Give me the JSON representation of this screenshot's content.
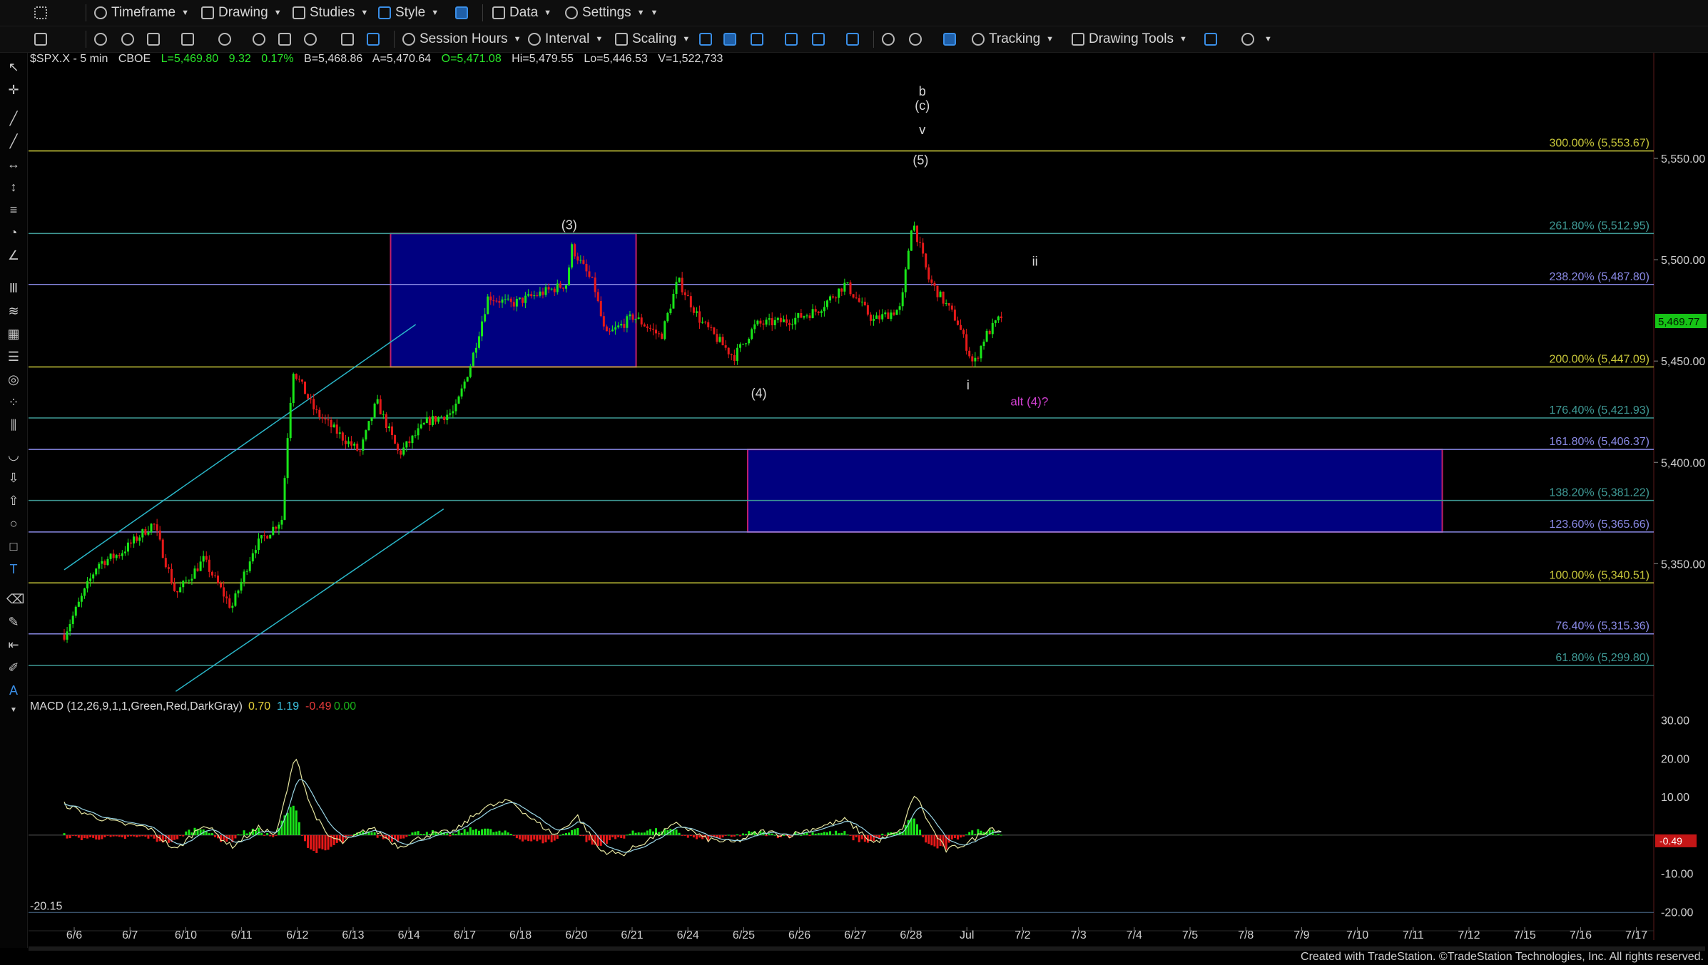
{
  "toolbar_top": {
    "timeframe": "Timeframe",
    "drawing": "Drawing",
    "studies": "Studies",
    "style": "Style",
    "data": "Data",
    "settings": "Settings"
  },
  "toolbar_second": {
    "session_hours": "Session Hours",
    "interval": "Interval",
    "scaling": "Scaling",
    "tracking": "Tracking",
    "drawing_tools": "Drawing Tools"
  },
  "symbol_bar": {
    "symbol": "$SPX.X - 5 min",
    "exchange": "CBOE",
    "last": "L=5,469.80",
    "change": "9.32",
    "change_pct": "0.17%",
    "bid": "B=5,468.86",
    "ask": "A=5,470.64",
    "open": "O=5,471.08",
    "high": "Hi=5,479.55",
    "low": "Lo=5,446.53",
    "volume": "V=1,522,733"
  },
  "footer": "Created with TradeStation. ©TradeStation Technologies, Inc. All rights reserved.",
  "colors": {
    "up": "#19e619",
    "down": "#e61919",
    "fib_yellow": "#c9c83a",
    "fib_blue": "#8a8ae6",
    "fib_teal": "#3f9a96",
    "box_fill": "#000080",
    "box_border": "#c0206a",
    "channel": "#2ab7c9"
  },
  "chart_data": [
    {
      "type": "candlestick",
      "title": "$SPX.X - 5 min",
      "x_labels": [
        "6/6",
        "6/7",
        "6/10",
        "6/11",
        "6/12",
        "6/13",
        "6/14",
        "6/17",
        "6/18",
        "6/20",
        "6/21",
        "6/24",
        "6/25",
        "6/26",
        "6/27",
        "6/28",
        "Jul",
        "7/2",
        "7/3",
        "7/4",
        "7/5",
        "7/8",
        "7/9",
        "7/10",
        "7/11",
        "7/12",
        "7/15",
        "7/16",
        "7/17"
      ],
      "ylim": [
        5285,
        5600
      ],
      "y_ticks": [
        "5,550.00",
        "5,500.00",
        "5,450.00",
        "5,400.00",
        "5,350.00"
      ],
      "y_tick_values": [
        5550,
        5500,
        5450,
        5400,
        5350
      ],
      "last_price_label": "5,469.77",
      "last_price": 5469.77,
      "price_path": [
        [
          0,
          5315
        ],
        [
          0.6,
          5350
        ],
        [
          1.0,
          5355
        ],
        [
          1.6,
          5370
        ],
        [
          2.0,
          5335
        ],
        [
          2.5,
          5352
        ],
        [
          3.0,
          5328
        ],
        [
          3.4,
          5358
        ],
        [
          3.9,
          5372
        ],
        [
          4.0,
          5412
        ],
        [
          4.1,
          5446
        ],
        [
          4.5,
          5425
        ],
        [
          5.0,
          5412
        ],
        [
          5.3,
          5405
        ],
        [
          5.6,
          5430
        ],
        [
          6.0,
          5404
        ],
        [
          6.5,
          5420
        ],
        [
          7.0,
          5425
        ],
        [
          7.3,
          5450
        ],
        [
          7.6,
          5482
        ],
        [
          8.0,
          5478
        ],
        [
          8.5,
          5483
        ],
        [
          9.0,
          5488
        ],
        [
          9.1,
          5506
        ],
        [
          9.5,
          5487
        ],
        [
          9.7,
          5462
        ],
        [
          10.2,
          5472
        ],
        [
          10.7,
          5462
        ],
        [
          11.0,
          5490
        ],
        [
          11.4,
          5470
        ],
        [
          12.0,
          5452
        ],
        [
          12.4,
          5468
        ],
        [
          13.0,
          5470
        ],
        [
          13.5,
          5475
        ],
        [
          14.0,
          5488
        ],
        [
          14.5,
          5470
        ],
        [
          15.0,
          5476
        ],
        [
          15.2,
          5520
        ],
        [
          15.5,
          5490
        ],
        [
          16.0,
          5470
        ],
        [
          16.3,
          5448
        ],
        [
          16.5,
          5462
        ],
        [
          16.8,
          5472
        ]
      ],
      "wave_labels": [
        {
          "text": "b",
          "x": 15.38,
          "y": 5581
        },
        {
          "text": "(c)",
          "x": 15.38,
          "y": 5574
        },
        {
          "text": "v",
          "x": 15.38,
          "y": 5562
        },
        {
          "text": "(5)",
          "x": 15.35,
          "y": 5547
        },
        {
          "text": "(3)",
          "x": 9.05,
          "y": 5515
        },
        {
          "text": "(4)",
          "x": 12.45,
          "y": 5432
        },
        {
          "text": "i",
          "x": 16.2,
          "y": 5436
        },
        {
          "text": "ii",
          "x": 17.4,
          "y": 5497
        },
        {
          "text": "alt (4)?",
          "x": 17.3,
          "y": 5428
        }
      ],
      "fib_levels": [
        {
          "label": "300.00% (5,553.67)",
          "value": 5553.67,
          "color": "yellow"
        },
        {
          "label": "261.80% (5,512.95)",
          "value": 5512.95,
          "color": "teal"
        },
        {
          "label": "238.20% (5,487.80)",
          "value": 5487.8,
          "color": "blue"
        },
        {
          "label": "200.00% (5,447.09)",
          "value": 5447.09,
          "color": "yellow"
        },
        {
          "label": "176.40% (5,421.93)",
          "value": 5421.93,
          "color": "teal"
        },
        {
          "label": "161.80% (5,406.37)",
          "value": 5406.37,
          "color": "blue"
        },
        {
          "label": "138.20% (5,381.22)",
          "value": 5381.22,
          "color": "teal"
        },
        {
          "label": "123.60% (5,365.66)",
          "value": 5365.66,
          "color": "blue"
        },
        {
          "label": "100.00% (5,340.51)",
          "value": 5340.51,
          "color": "yellow"
        },
        {
          "label": "76.40% (5,315.36)",
          "value": 5315.36,
          "color": "blue"
        },
        {
          "label": "61.80% (5,299.80)",
          "value": 5299.8,
          "color": "teal"
        }
      ],
      "target_boxes": [
        {
          "x0": 5.85,
          "x1": 10.25,
          "y0": 5447.09,
          "y1": 5512.95
        },
        {
          "x0": 12.25,
          "x1": 24.7,
          "y0": 5365.66,
          "y1": 5406.37
        }
      ],
      "channel_lines": [
        {
          "x0": 0,
          "y0": 5347,
          "x1": 6.3,
          "y1": 5468
        },
        {
          "x0": 2.0,
          "y0": 5287,
          "x1": 6.8,
          "y1": 5377
        }
      ]
    },
    {
      "type": "line",
      "title": "MACD (12,26,9,1,1,Green,Red,DarkGray)",
      "values_text": [
        "0.70",
        "1.19",
        "-0.49",
        "0.00"
      ],
      "ylim": [
        -24,
        34
      ],
      "y_ticks": [
        "30.00",
        "20.00",
        "10.00",
        "-10.00",
        "-20.00"
      ],
      "y_tick_values": [
        30,
        20,
        10,
        -10,
        -20
      ],
      "last_value_label": "-0.49",
      "min_label": "-20.15",
      "min_value": -20.15,
      "macd_path": [
        [
          0,
          8
        ],
        [
          0.5,
          5
        ],
        [
          1.0,
          3
        ],
        [
          1.5,
          2
        ],
        [
          2.0,
          -4
        ],
        [
          2.5,
          3
        ],
        [
          3.0,
          -3
        ],
        [
          3.5,
          2
        ],
        [
          3.8,
          0
        ],
        [
          4.0,
          12
        ],
        [
          4.15,
          21
        ],
        [
          4.4,
          8
        ],
        [
          4.7,
          0
        ],
        [
          5.0,
          -2
        ],
        [
          5.5,
          2
        ],
        [
          6.0,
          -3
        ],
        [
          6.5,
          0
        ],
        [
          7.0,
          1
        ],
        [
          7.5,
          7
        ],
        [
          8.0,
          9
        ],
        [
          8.4,
          4
        ],
        [
          8.8,
          0
        ],
        [
          9.2,
          5
        ],
        [
          9.6,
          -4
        ],
        [
          10.0,
          -5
        ],
        [
          10.5,
          -1
        ],
        [
          11.0,
          3
        ],
        [
          11.5,
          -1
        ],
        [
          12.0,
          -2
        ],
        [
          12.5,
          1
        ],
        [
          13.0,
          0
        ],
        [
          13.5,
          2
        ],
        [
          14.0,
          4
        ],
        [
          14.5,
          -2
        ],
        [
          15.0,
          1
        ],
        [
          15.25,
          11
        ],
        [
          15.5,
          3
        ],
        [
          15.8,
          -4
        ],
        [
          16.2,
          -2
        ],
        [
          16.6,
          2
        ],
        [
          16.8,
          1
        ]
      ]
    }
  ]
}
